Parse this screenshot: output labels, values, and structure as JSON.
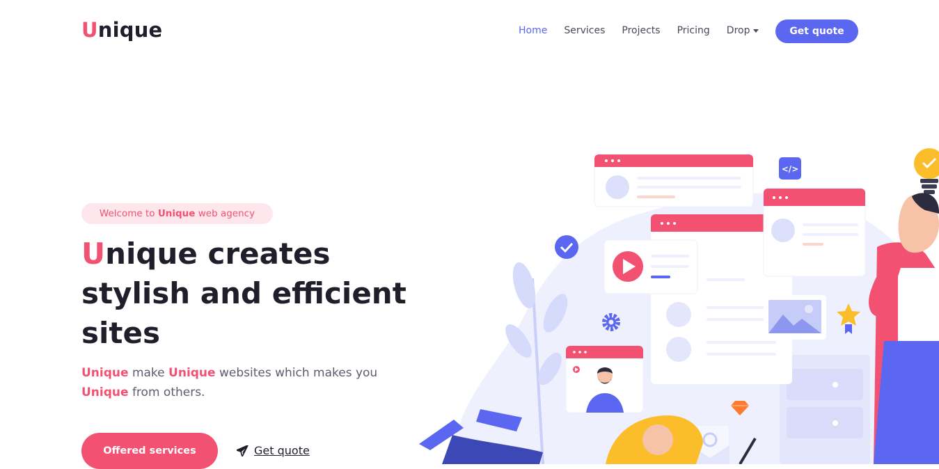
{
  "header": {
    "logo_initial": "U",
    "logo_rest": "nique",
    "nav": [
      {
        "label": "Home"
      },
      {
        "label": "Services"
      },
      {
        "label": "Projects"
      },
      {
        "label": "Pricing"
      },
      {
        "label": "Drop"
      }
    ],
    "cta_label": "Get quote"
  },
  "hero": {
    "badge_pre": "Welcome to ",
    "badge_brand": "Unique",
    "badge_post": " web agency",
    "title_initial": "U",
    "title_rest": "nique creates stylish and efficient sites",
    "sub_brand1": "Unique",
    "sub_text1": " make ",
    "sub_brand2": "Unique",
    "sub_text2": " websites which makes you ",
    "sub_brand3": "Unique",
    "sub_text3": " from others.",
    "primary_button": "Offered services",
    "secondary_link": "Get quote",
    "secondary_icon": "paper-plane-icon"
  },
  "colors": {
    "accent": "#f25172",
    "brand": "#5b67f0",
    "text": "#1f1f2b",
    "badge_bg": "#fde7ec"
  },
  "illustration": {
    "code_icon": "</>",
    "icons": [
      "check-circle-icon",
      "play-icon",
      "gear-icon",
      "star-icon",
      "lightbulb-icon",
      "gem-icon",
      "image-icon",
      "mail-icon"
    ]
  }
}
